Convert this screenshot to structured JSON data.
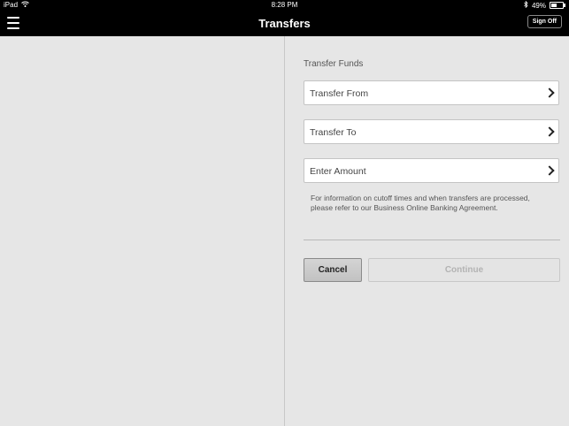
{
  "status_bar": {
    "device": "iPad",
    "time": "8:28 PM",
    "battery": "49%",
    "battery_level": 0.49,
    "icons": [
      "wifi-icon",
      "bluetooth-icon",
      "battery-icon"
    ]
  },
  "navbar": {
    "title": "Transfers",
    "signoff_label": "Sign Off",
    "menu_icon": "hamburger-menu-icon"
  },
  "form": {
    "section_title": "Transfer Funds",
    "fields": [
      {
        "label": "Transfer From"
      },
      {
        "label": "Transfer To"
      },
      {
        "label": "Enter Amount"
      }
    ],
    "info_text": "For information on cutoff times and when transfers are processed, please refer to our Business Online Banking Agreement.",
    "cancel_label": "Cancel",
    "continue_label": "Continue"
  },
  "colors": {
    "bar_background": "#000000",
    "page_background": "#e6e6e6",
    "disabled_text": "#b3b3b3"
  }
}
